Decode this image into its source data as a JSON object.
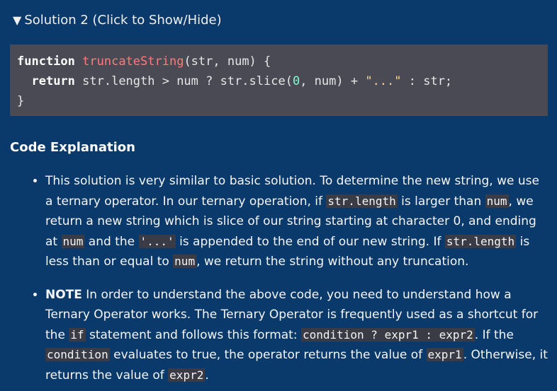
{
  "summary": {
    "icon": "triangle-down-icon",
    "glyph": "▼",
    "label": "Solution 2 (Click to Show/Hide)"
  },
  "code": {
    "line1_kw": "function",
    "line1_name": "truncateString",
    "line1_rest": "(str, num) {",
    "line2_indent": "  ",
    "line2_kw": "return",
    "line2_a": " str.length > num ? str.slice(",
    "line2_num": "0",
    "line2_b": ", num) + ",
    "line2_str": "\"...\"",
    "line2_c": " : str;",
    "line3": "}"
  },
  "explanation": {
    "heading": "Code Explanation",
    "item1": {
      "t1": "This solution is very similar to basic solution. To determine the new string, we use a ternary operator. In our ternary operation, if ",
      "c1": "str.length",
      "t2": " is larger than ",
      "c2": "num",
      "t3": ", we return a new string which is slice of our string starting at character 0, and ending at ",
      "c3": "num",
      "t4": " and the ",
      "c4": "'...'",
      "t5": " is appended to the end of our new string. If ",
      "c5": "str.length",
      "t6": " is less than or equal to ",
      "c6": "num",
      "t7": ", we return the string without any truncation."
    },
    "item2": {
      "bold": "NOTE",
      "t1": " In order to understand the above code, you need to understand how a Ternary Operator works. The Ternary Operator is frequently used as a shortcut for the ",
      "c1": "if",
      "t2": " statement and follows this format: ",
      "c2": "condition ? expr1 : expr2",
      "t3": ". If the ",
      "c3": "condition",
      "t4": " evaluates to true, the operator returns the value of ",
      "c4": "expr1",
      "t5": ". Otherwise, it returns the value of ",
      "c5": "expr2",
      "t6": "."
    }
  }
}
